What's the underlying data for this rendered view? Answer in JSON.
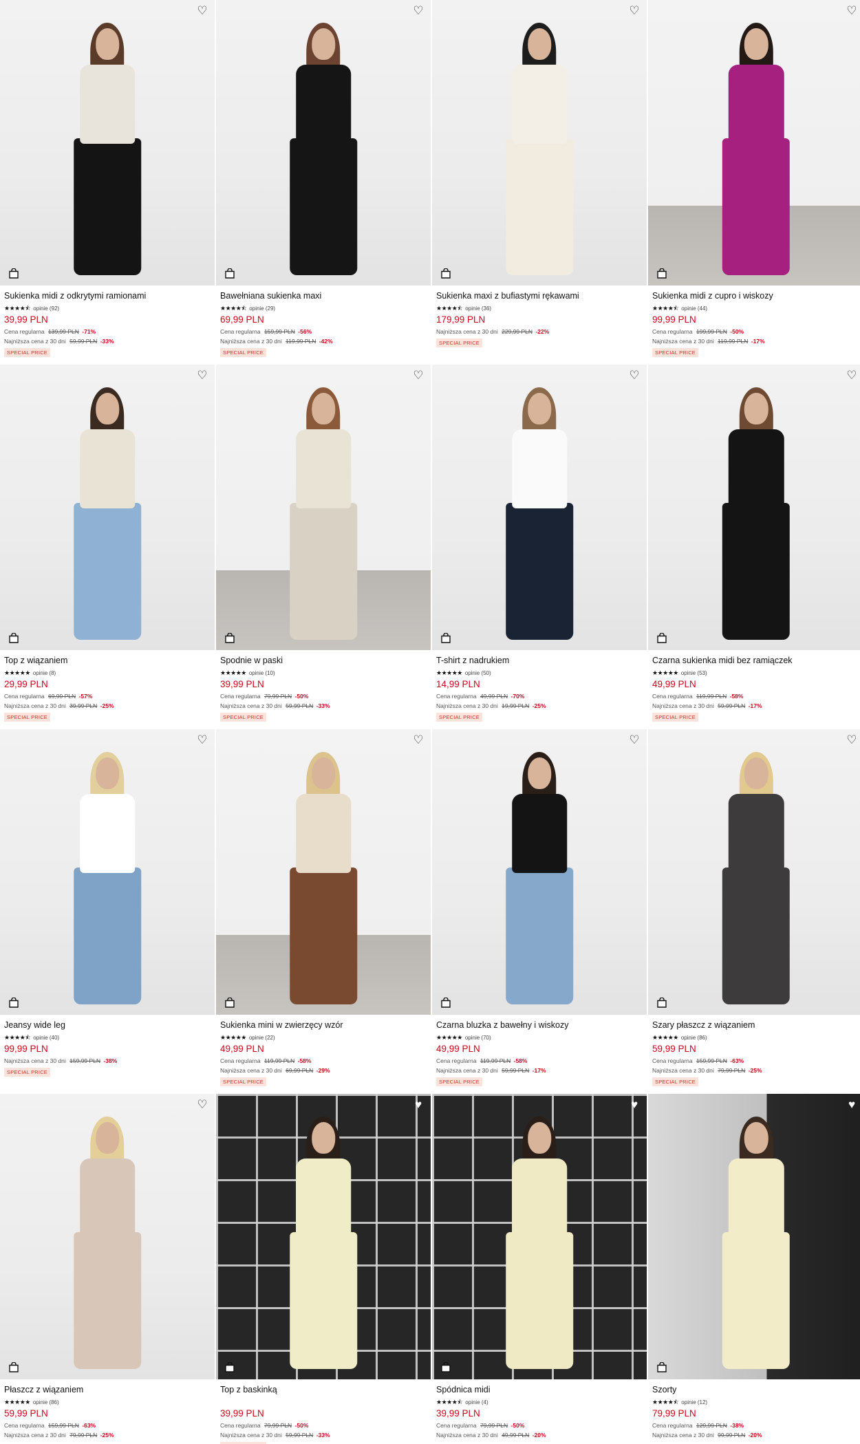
{
  "colors": {
    "price": "#d0021b",
    "badge_bg": "#fbe3dc",
    "badge_text": "#c0392b"
  },
  "icons": {
    "wishlist": "heart-icon",
    "cart": "shopping-bag-icon",
    "rating": "star-icon"
  },
  "products": [
    {
      "name": "Sukienka midi z odkrytymi ramionami",
      "rating": 4.5,
      "stars": "★★★★⯪",
      "reviews": "opinie (92)",
      "price": "39,99 PLN",
      "wishlisted": false,
      "regular_label": "Cena regularna",
      "regular_price": "139,99 PLN",
      "regular_discount": "-71%",
      "lowest_label": "Najniższa cena z 30 dni",
      "lowest_price": "59,99 PLN",
      "lowest_discount": "-33%",
      "badge": "SPECIAL PRICE",
      "photo": {
        "bg": "light",
        "hair": "#5a3a28",
        "top": "#e8e4dc",
        "bottom": "#141414"
      }
    },
    {
      "name": "Bawełniana sukienka maxi",
      "rating": 4.5,
      "stars": "★★★★⯪",
      "reviews": "opinie (29)",
      "price": "69,99 PLN",
      "wishlisted": false,
      "regular_label": "Cena regularna",
      "regular_price": "159,99 PLN",
      "regular_discount": "-56%",
      "lowest_label": "Najniższa cena z 30 dni",
      "lowest_price": "119,99 PLN",
      "lowest_discount": "-42%",
      "badge": "SPECIAL PRICE",
      "photo": {
        "bg": "light",
        "hair": "#6b4330",
        "top": "#151515",
        "bottom": "#151515"
      }
    },
    {
      "name": "Sukienka maxi z bufiastymi rękawami",
      "rating": 4.5,
      "stars": "★★★★⯪",
      "reviews": "opinie (36)",
      "price": "179,99 PLN",
      "wishlisted": false,
      "regular_label": "",
      "regular_price": "",
      "regular_discount": "",
      "lowest_label": "Najniższa cena z 30 dni",
      "lowest_price": "229,99 PLN",
      "lowest_discount": "-22%",
      "badge": "SPECIAL PRICE",
      "photo": {
        "bg": "light",
        "hair": "#1d1d1d",
        "top": "#f4efe6",
        "bottom": "#f1ebe0"
      }
    },
    {
      "name": "Sukienka midi z cupro i wiskozy",
      "rating": 4.5,
      "stars": "★★★★⯪",
      "reviews": "opinie (44)",
      "price": "99,99 PLN",
      "wishlisted": false,
      "regular_label": "Cena regularna",
      "regular_price": "199,99 PLN",
      "regular_discount": "-50%",
      "lowest_label": "Najniższa cena z 30 dni",
      "lowest_price": "119,99 PLN",
      "lowest_discount": "-17%",
      "badge": "SPECIAL PRICE",
      "photo": {
        "bg": "floor",
        "hair": "#231a16",
        "top": "#a5207f",
        "bottom": "#a5207f"
      }
    },
    {
      "name": "Top z wiązaniem",
      "rating": 5,
      "stars": "★★★★★",
      "reviews": "opinie (8)",
      "price": "29,99 PLN",
      "wishlisted": false,
      "regular_label": "Cena regularna",
      "regular_price": "69,99 PLN",
      "regular_discount": "-57%",
      "lowest_label": "Najniższa cena z 30 dni",
      "lowest_price": "39,99 PLN",
      "lowest_discount": "-25%",
      "badge": "SPECIAL PRICE",
      "photo": {
        "bg": "light",
        "hair": "#3a2a20",
        "top": "#e9e3d6",
        "bottom": "#8fb1d3"
      }
    },
    {
      "name": "Spodnie w paski",
      "rating": 5,
      "stars": "★★★★★",
      "reviews": "opinie (10)",
      "price": "39,99 PLN",
      "wishlisted": false,
      "regular_label": "Cena regularna",
      "regular_price": "79,99 PLN",
      "regular_discount": "-50%",
      "lowest_label": "Najniższa cena z 30 dni",
      "lowest_price": "59,99 PLN",
      "lowest_discount": "-33%",
      "badge": "SPECIAL PRICE",
      "photo": {
        "bg": "floor",
        "hair": "#8a5a3a",
        "top": "#e9e3d6",
        "bottom": "#d9d2c4"
      }
    },
    {
      "name": "T-shirt z nadrukiem",
      "rating": 5,
      "stars": "★★★★★",
      "reviews": "opinie (50)",
      "price": "14,99 PLN",
      "wishlisted": false,
      "regular_label": "Cena regularna",
      "regular_price": "49,99 PLN",
      "regular_discount": "-70%",
      "lowest_label": "Najniższa cena z 30 dni",
      "lowest_price": "19,99 PLN",
      "lowest_discount": "-25%",
      "badge": "SPECIAL PRICE",
      "photo": {
        "bg": "light",
        "hair": "#8a6a4a",
        "top": "#fafafa",
        "bottom": "#1a2333"
      }
    },
    {
      "name": "Czarna sukienka midi bez ramiączek",
      "rating": 5,
      "stars": "★★★★★",
      "reviews": "opinie (53)",
      "price": "49,99 PLN",
      "wishlisted": false,
      "regular_label": "Cena regularna",
      "regular_price": "119,99 PLN",
      "regular_discount": "-58%",
      "lowest_label": "Najniższa cena z 30 dni",
      "lowest_price": "59,99 PLN",
      "lowest_discount": "-17%",
      "badge": "SPECIAL PRICE",
      "photo": {
        "bg": "light",
        "hair": "#6e4a32",
        "top": "#141414",
        "bottom": "#141414"
      }
    },
    {
      "name": "Jeansy wide leg",
      "rating": 4.5,
      "stars": "★★★★⯪",
      "reviews": "opinie (40)",
      "price": "99,99 PLN",
      "wishlisted": false,
      "regular_label": "",
      "regular_price": "",
      "regular_discount": "",
      "lowest_label": "Najniższa cena z 30 dni",
      "lowest_price": "159,99 PLN",
      "lowest_discount": "-38%",
      "badge": "SPECIAL PRICE",
      "photo": {
        "bg": "light",
        "hair": "#e2cf9c",
        "top": "#ffffff",
        "bottom": "#7fa3c6"
      }
    },
    {
      "name": "Sukienka mini w zwierzęcy wzór",
      "rating": 5,
      "stars": "★★★★★",
      "reviews": "opinie (22)",
      "price": "49,99 PLN",
      "wishlisted": false,
      "regular_label": "Cena regularna",
      "regular_price": "119,99 PLN",
      "regular_discount": "-58%",
      "lowest_label": "Najniższa cena z 30 dni",
      "lowest_price": "69,99 PLN",
      "lowest_discount": "-29%",
      "badge": "SPECIAL PRICE",
      "photo": {
        "bg": "floor",
        "hair": "#dcc38e",
        "top": "#e8dccb",
        "bottom": "#7a4a30"
      }
    },
    {
      "name": "Czarna bluzka z bawełny i wiskozy",
      "rating": 5,
      "stars": "★★★★★",
      "reviews": "opinie (70)",
      "price": "49,99 PLN",
      "wishlisted": false,
      "regular_label": "Cena regularna",
      "regular_price": "119,99 PLN",
      "regular_discount": "-58%",
      "lowest_label": "Najniższa cena z 30 dni",
      "lowest_price": "59,99 PLN",
      "lowest_discount": "-17%",
      "badge": "SPECIAL PRICE",
      "photo": {
        "bg": "light",
        "hair": "#2a1e18",
        "top": "#141414",
        "bottom": "#86a8cb"
      }
    },
    {
      "name": "Szary płaszcz z wiązaniem",
      "rating": 5,
      "stars": "★★★★★",
      "reviews": "opinie (86)",
      "price": "59,99 PLN",
      "wishlisted": false,
      "regular_label": "Cena regularna",
      "regular_price": "159,99 PLN",
      "regular_discount": "-63%",
      "lowest_label": "Najniższa cena z 30 dni",
      "lowest_price": "79,99 PLN",
      "lowest_discount": "-25%",
      "badge": "SPECIAL PRICE",
      "photo": {
        "bg": "light",
        "hair": "#e2c98e",
        "top": "#3d3b3b",
        "bottom": "#3d3b3b"
      }
    },
    {
      "name": "Płaszcz z wiązaniem",
      "rating": 5,
      "stars": "★★★★★",
      "reviews": "opinie (86)",
      "price": "59,99 PLN",
      "wishlisted": false,
      "regular_label": "Cena regularna",
      "regular_price": "159,99 PLN",
      "regular_discount": "-63%",
      "lowest_label": "Najniższa cena z 30 dni",
      "lowest_price": "79,99 PLN",
      "lowest_discount": "-25%",
      "badge": "",
      "photo": {
        "bg": "light",
        "hair": "#e4cf98",
        "top": "#d8c6b8",
        "bottom": "#d8c6b8"
      }
    },
    {
      "name": "Top z baskinką",
      "rating": 0,
      "stars": "",
      "reviews": "",
      "price": "39,99 PLN",
      "wishlisted": true,
      "regular_label": "Cena regularna",
      "regular_price": "79,99 PLN",
      "regular_discount": "-50%",
      "lowest_label": "Najniższa cena z 30 dni",
      "lowest_price": "59,99 PLN",
      "lowest_discount": "-33%",
      "badge": "SPECIAL PRICE",
      "photo": {
        "bg": "darkgrid",
        "hair": "#2a1e18",
        "top": "#f1ecc8",
        "bottom": "#f1ecc8"
      }
    },
    {
      "name": "Spódnica midi",
      "rating": 4.5,
      "stars": "★★★★⯪",
      "reviews": "opinie (4)",
      "price": "39,99 PLN",
      "wishlisted": true,
      "regular_label": "Cena regularna",
      "regular_price": "79,99 PLN",
      "regular_discount": "-50%",
      "lowest_label": "Najniższa cena z 30 dni",
      "lowest_price": "49,99 PLN",
      "lowest_discount": "-20%",
      "badge": "",
      "photo": {
        "bg": "darkgrid",
        "hair": "#2a1e18",
        "top": "#efe9c4",
        "bottom": "#efe9c4"
      }
    },
    {
      "name": "Szorty",
      "rating": 4.5,
      "stars": "★★★★⯪",
      "reviews": "opinie (12)",
      "price": "79,99 PLN",
      "wishlisted": true,
      "regular_label": "Cena regularna",
      "regular_price": "129,99 PLN",
      "regular_discount": "-38%",
      "lowest_label": "Najniższa cena z 30 dni",
      "lowest_price": "99,99 PLN",
      "lowest_discount": "-20%",
      "badge": "",
      "photo": {
        "bg": "darkwall",
        "hair": "#3a2a20",
        "top": "#f2edc8",
        "bottom": "#f2edc8"
      }
    }
  ]
}
